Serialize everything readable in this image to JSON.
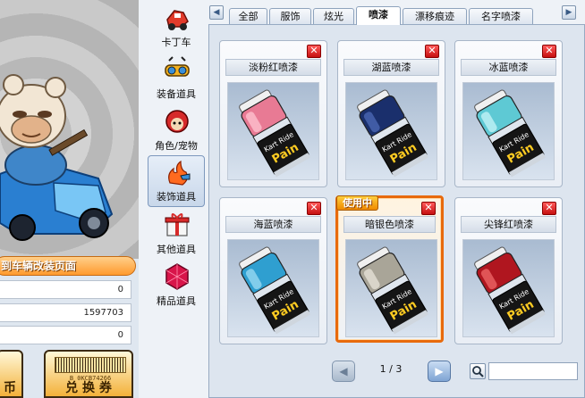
{
  "showcase": {
    "caption": "到车辆改装页面",
    "stats": [
      "0",
      "1597703",
      "0"
    ],
    "left_button_label": "币",
    "right_button_label": "兑 换 券",
    "barcode_text": "B  0KCB74266"
  },
  "categories": [
    {
      "label": "卡丁车",
      "icon": "kart-icon"
    },
    {
      "label": "装备道具",
      "icon": "goggles-icon"
    },
    {
      "label": "角色/宠物",
      "icon": "character-icon"
    },
    {
      "label": "装饰道具",
      "icon": "decoration-icon",
      "selected": true
    },
    {
      "label": "其他道具",
      "icon": "gift-box-icon"
    },
    {
      "label": "精品道具",
      "icon": "ruby-gem-icon"
    }
  ],
  "tabs": {
    "items": [
      "全部",
      "服饰",
      "炫光",
      "喷漆",
      "漂移痕迹",
      "名字喷漆"
    ],
    "active": "喷漆",
    "prev_arrow": "◀",
    "next_arrow": "▶"
  },
  "items": [
    {
      "name": "淡粉红喷漆",
      "color": "#e87a94",
      "light": "#ffc5d2",
      "in_use": false
    },
    {
      "name": "湖蓝喷漆",
      "color": "#1a2f6c",
      "light": "#4d6bb8",
      "in_use": false
    },
    {
      "name": "冰蓝喷漆",
      "color": "#5ec9d4",
      "light": "#c9f4f8",
      "in_use": false
    },
    {
      "name": "海蓝喷漆",
      "color": "#2f9fd0",
      "light": "#9fdcf4",
      "in_use": false
    },
    {
      "name": "暗银色喷漆",
      "color": "#a9a598",
      "light": "#e9e6db",
      "in_use": true
    },
    {
      "name": "尖锋红喷漆",
      "color": "#b0161f",
      "light": "#f06a6a",
      "in_use": false
    }
  ],
  "in_use_label": "使用中",
  "close_glyph": "✕",
  "can_text_line1": "Kart Ride",
  "can_text_line2": "Pain",
  "pagination": {
    "current": "1",
    "total": "3",
    "separator": "/",
    "prev": "◀",
    "next": "▶"
  },
  "search": {
    "value": "",
    "placeholder": ""
  }
}
